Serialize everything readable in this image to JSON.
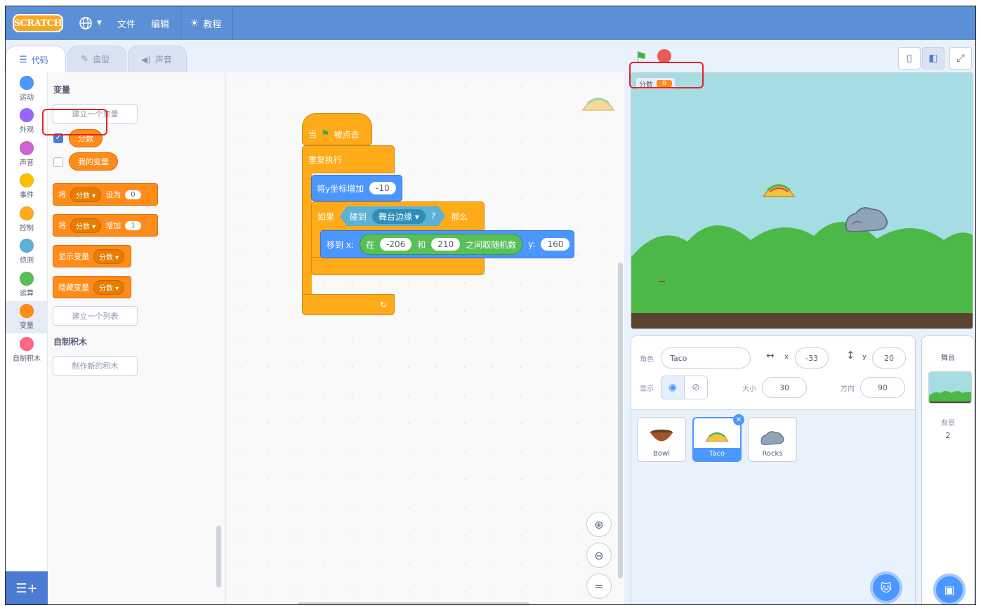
{
  "menubar": {
    "logo": "SCRATCH",
    "file": "文件",
    "edit": "编辑",
    "tutorials": "教程"
  },
  "tabs": {
    "code": "代码",
    "costumes": "造型",
    "sounds": "声音"
  },
  "categories": [
    {
      "label": "运动",
      "color": "#4c97ff"
    },
    {
      "label": "外观",
      "color": "#9966ff"
    },
    {
      "label": "声音",
      "color": "#cf63cf"
    },
    {
      "label": "事件",
      "color": "#ffbf00"
    },
    {
      "label": "控制",
      "color": "#ffab19"
    },
    {
      "label": "侦测",
      "color": "#5cb1d6"
    },
    {
      "label": "运算",
      "color": "#59c059"
    },
    {
      "label": "变量",
      "color": "#ff8c1a"
    },
    {
      "label": "自制积木",
      "color": "#ff6680"
    }
  ],
  "palette": {
    "variables_title": "变量",
    "make_variable": "建立一个变量",
    "var_score": "分数",
    "var_mine": "我的变量",
    "set_prefix": "将",
    "set_var": "分数",
    "set_mid": "设为",
    "set_value": "0",
    "change_prefix": "将",
    "change_var": "分数",
    "change_mid": "增加",
    "change_value": "1",
    "show_var": "显示变量",
    "show_var_dd": "分数",
    "hide_var": "隐藏变量",
    "hide_var_dd": "分数",
    "make_list": "建立一个列表",
    "myblocks_title": "自制积木",
    "make_block": "制作新的积木"
  },
  "script": {
    "hat_when": "当",
    "hat_clicked": "被点击",
    "forever": "重复执行",
    "change_y": "将y坐标增加",
    "change_y_value": "-10",
    "if": "如果",
    "touching": "碰到",
    "touching_dd": "舞台边缘",
    "question": "?",
    "then": "那么",
    "goto": "移到 x:",
    "random_in": "在",
    "random_from": "-206",
    "random_and": "和",
    "random_to": "210",
    "random_label": "之间取随机数",
    "goto_y": "y:",
    "goto_y_value": "160"
  },
  "stage_monitor": {
    "label": "分数",
    "value": "0"
  },
  "sprite_info": {
    "sprite_label": "角色",
    "sprite_name": "Taco",
    "x_label": "x",
    "x_value": "-33",
    "y_label": "y",
    "y_value": "20",
    "show_label": "显示",
    "size_label": "大小",
    "size_value": "30",
    "direction_label": "方向",
    "direction_value": "90"
  },
  "sprites": [
    "Bowl",
    "Taco",
    "Rocks"
  ],
  "stage_panel": {
    "title": "舞台",
    "backdrops_label": "背景",
    "backdrops_count": "2"
  }
}
